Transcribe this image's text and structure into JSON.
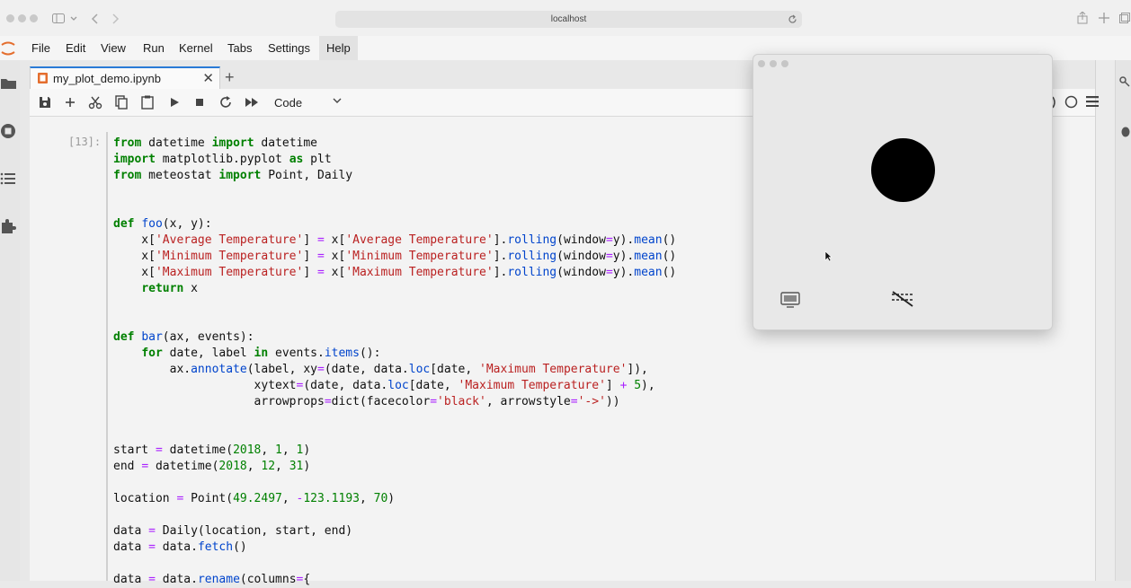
{
  "browser": {
    "url": "localhost"
  },
  "menu": [
    {
      "label": "File"
    },
    {
      "label": "Edit"
    },
    {
      "label": "View"
    },
    {
      "label": "Run"
    },
    {
      "label": "Kernel"
    },
    {
      "label": "Tabs"
    },
    {
      "label": "Settings"
    },
    {
      "label": "Help"
    }
  ],
  "tab": {
    "title": "my_plot_demo.ipynb",
    "close": "✕",
    "new": "+"
  },
  "toolbar": {
    "cell_type": "Code"
  },
  "cell": {
    "prompt": "[13]:"
  },
  "colors": {
    "accent": "#2a7bd6",
    "keyword": "#008000",
    "string": "#ba2121",
    "function": "#0044cc"
  },
  "code_lines": [
    "from datetime import datetime",
    "import matplotlib.pyplot as plt",
    "from meteostat import Point, Daily",
    "",
    "",
    "def foo(x, y):",
    "    x['Average Temperature'] = x['Average Temperature'].rolling(window=y).mean()",
    "    x['Minimum Temperature'] = x['Minimum Temperature'].rolling(window=y).mean()",
    "    x['Maximum Temperature'] = x['Maximum Temperature'].rolling(window=y).mean()",
    "    return x",
    "",
    "",
    "def bar(ax, events):",
    "    for date, label in events.items():",
    "        ax.annotate(label, xy=(date, data.loc[date, 'Maximum Temperature']),",
    "                    xytext=(date, data.loc[date, 'Maximum Temperature'] + 5),",
    "                    arrowprops=dict(facecolor='black', arrowstyle='->'))",
    "",
    "",
    "start = datetime(2018, 1, 1)",
    "end = datetime(2018, 12, 31)",
    "",
    "location = Point(49.2497, -123.1193, 70)",
    "",
    "data = Daily(location, start, end)",
    "data = data.fetch()",
    "",
    "data = data.rename(columns={"
  ]
}
